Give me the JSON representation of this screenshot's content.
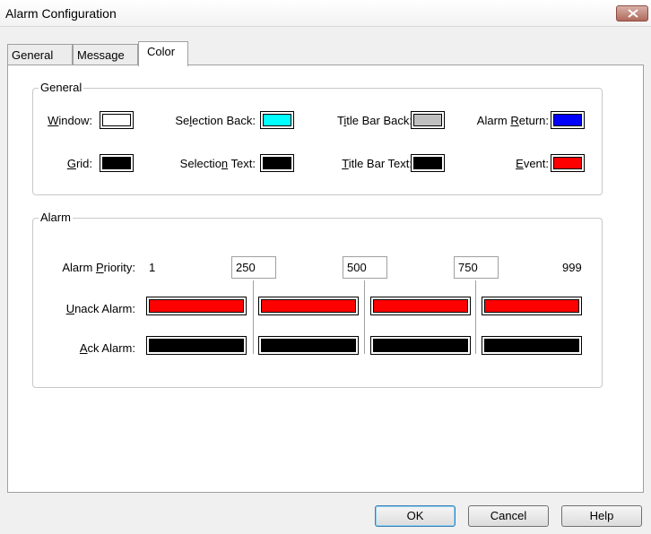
{
  "window": {
    "title": "Alarm Configuration"
  },
  "tabs": [
    {
      "label": "General",
      "active": false
    },
    {
      "label": "Message",
      "active": false
    },
    {
      "label": "Color",
      "active": true
    }
  ],
  "general_group": {
    "title": "General",
    "items": [
      {
        "label": "Window:",
        "color": "#ffffff"
      },
      {
        "label": "Selection Back:",
        "color": "#00ffff"
      },
      {
        "label": "Title Bar Back:",
        "color": "#c0c0c0"
      },
      {
        "label": "Alarm Return:",
        "color": "#0000ff"
      },
      {
        "label": "Grid:",
        "color": "#000000"
      },
      {
        "label": "Selection Text:",
        "color": "#000000"
      },
      {
        "label": "Title Bar Text:",
        "color": "#000000"
      },
      {
        "label": "Event:",
        "color": "#ff0000"
      }
    ]
  },
  "alarm_group": {
    "title": "Alarm",
    "priority_label": "Alarm Priority:",
    "priority_min": "1",
    "priority_max": "999",
    "thresholds": [
      "250",
      "500",
      "750"
    ],
    "unack_label": "Unack Alarm:",
    "ack_label": "Ack Alarm:",
    "unack_colors": [
      "#ff0000",
      "#ff0000",
      "#ff0000",
      "#ff0000"
    ],
    "ack_colors": [
      "#000000",
      "#000000",
      "#000000",
      "#000000"
    ]
  },
  "buttons": {
    "ok": "OK",
    "cancel": "Cancel",
    "help": "Help"
  }
}
